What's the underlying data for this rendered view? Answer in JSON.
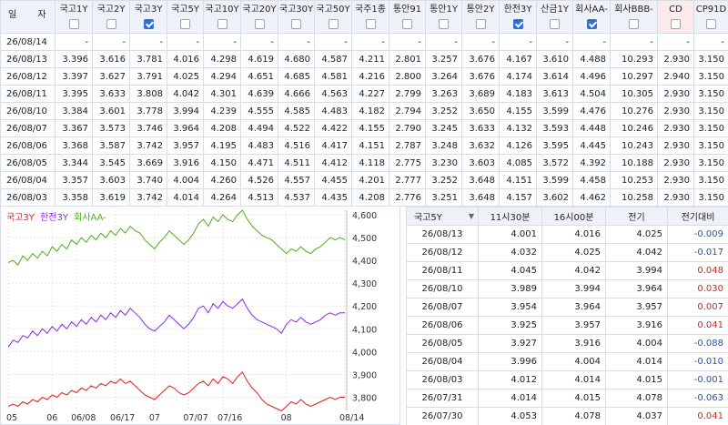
{
  "top": {
    "date_header": "일 자",
    "columns": [
      {
        "label": "국고1Y",
        "checked": false
      },
      {
        "label": "국고2Y",
        "checked": false
      },
      {
        "label": "국고3Y",
        "checked": true
      },
      {
        "label": "국고5Y",
        "checked": false
      },
      {
        "label": "국고10Y",
        "checked": false
      },
      {
        "label": "국고20Y",
        "checked": false
      },
      {
        "label": "국고30Y",
        "checked": false
      },
      {
        "label": "국고50Y",
        "checked": false
      },
      {
        "label": "국주1종",
        "checked": false
      },
      {
        "label": "통안91",
        "checked": false
      },
      {
        "label": "통안1Y",
        "checked": false
      },
      {
        "label": "통안2Y",
        "checked": false
      },
      {
        "label": "한전3Y",
        "checked": true
      },
      {
        "label": "산금1Y",
        "checked": false
      },
      {
        "label": "회사AA-",
        "checked": true
      },
      {
        "label": "회사BBB-",
        "checked": false
      },
      {
        "label": "CD",
        "checked": false
      },
      {
        "label": "CP91D",
        "checked": false
      }
    ],
    "rows": [
      {
        "date": "26/08/14",
        "values": [
          "-",
          "-",
          "-",
          "-",
          "-",
          "-",
          "-",
          "-",
          "-",
          "-",
          "-",
          "-",
          "-",
          "-",
          "-",
          "-",
          "-",
          "-"
        ]
      },
      {
        "date": "26/08/13",
        "values": [
          "3.396",
          "3.616",
          "3.781",
          "4.016",
          "4.298",
          "4.619",
          "4.680",
          "4.587",
          "4.211",
          "2.801",
          "3.257",
          "3.676",
          "4.167",
          "3.610",
          "4.488",
          "10.293",
          "2.930",
          "3.150"
        ]
      },
      {
        "date": "26/08/12",
        "values": [
          "3.397",
          "3.627",
          "3.791",
          "4.025",
          "4.294",
          "4.651",
          "4.685",
          "4.581",
          "4.216",
          "2.800",
          "3.264",
          "3.676",
          "4.174",
          "3.614",
          "4.496",
          "10.297",
          "2.940",
          "3.150"
        ]
      },
      {
        "date": "26/08/11",
        "values": [
          "3.395",
          "3.633",
          "3.808",
          "4.042",
          "4.301",
          "4.639",
          "4.666",
          "4.563",
          "4.227",
          "2.799",
          "3.263",
          "3.689",
          "4.183",
          "3.613",
          "4.504",
          "10.305",
          "2.930",
          "3.150"
        ]
      },
      {
        "date": "26/08/10",
        "values": [
          "3.384",
          "3.601",
          "3.778",
          "3.994",
          "4.239",
          "4.555",
          "4.585",
          "4.483",
          "4.182",
          "2.794",
          "3.252",
          "3.650",
          "4.155",
          "3.599",
          "4.476",
          "10.276",
          "2.930",
          "3.150"
        ]
      },
      {
        "date": "26/08/07",
        "values": [
          "3.367",
          "3.573",
          "3.746",
          "3.964",
          "4.208",
          "4.494",
          "4.522",
          "4.422",
          "4.155",
          "2.790",
          "3.245",
          "3.633",
          "4.132",
          "3.593",
          "4.448",
          "10.246",
          "2.930",
          "3.150"
        ]
      },
      {
        "date": "26/08/06",
        "values": [
          "3.368",
          "3.587",
          "3.742",
          "3.957",
          "4.195",
          "4.483",
          "4.516",
          "4.417",
          "4.151",
          "2.787",
          "3.248",
          "3.632",
          "4.126",
          "3.595",
          "4.445",
          "10.243",
          "2.930",
          "3.150"
        ]
      },
      {
        "date": "26/08/05",
        "values": [
          "3.344",
          "3.545",
          "3.669",
          "3.916",
          "4.150",
          "4.471",
          "4.511",
          "4.412",
          "4.118",
          "2.775",
          "3.230",
          "3.603",
          "4.085",
          "3.572",
          "4.392",
          "10.188",
          "2.930",
          "3.150"
        ]
      },
      {
        "date": "26/08/04",
        "values": [
          "3.357",
          "3.603",
          "3.740",
          "4.004",
          "4.260",
          "4.526",
          "4.557",
          "4.455",
          "4.201",
          "2.777",
          "3.252",
          "3.648",
          "4.151",
          "3.599",
          "4.458",
          "10.253",
          "2.930",
          "3.150"
        ]
      },
      {
        "date": "26/08/03",
        "values": [
          "3.358",
          "3.619",
          "3.742",
          "4.014",
          "4.264",
          "4.513",
          "4.537",
          "4.435",
          "4.208",
          "2.776",
          "3.251",
          "3.648",
          "4.157",
          "3.602",
          "4.462",
          "10.258",
          "2.930",
          "3.150"
        ]
      }
    ]
  },
  "chart": {
    "legend": [
      {
        "label": "국고3Y",
        "color": "#e02020"
      },
      {
        "label": "한전3Y",
        "color": "#8a2be2"
      },
      {
        "label": "회사AA-",
        "color": "#4caf1a"
      }
    ],
    "x_ticks": [
      "05",
      "06",
      "06/08",
      "06/17",
      "07",
      "07/07",
      "07/16",
      "08",
      "08/14"
    ],
    "y_ticks": [
      "4,600",
      "4,500",
      "4,400",
      "4,300",
      "4,200",
      "4,100",
      "4,000",
      "3,900",
      "3,800"
    ]
  },
  "chart_data": {
    "type": "line",
    "ylim": [
      3.75,
      4.62
    ],
    "x_count": 70,
    "series": [
      {
        "name": "회사AA-",
        "color": "#4caf1a",
        "values": [
          4.39,
          4.4,
          4.38,
          4.42,
          4.4,
          4.43,
          4.41,
          4.44,
          4.42,
          4.46,
          4.44,
          4.47,
          4.45,
          4.49,
          4.47,
          4.5,
          4.48,
          4.51,
          4.49,
          4.52,
          4.5,
          4.53,
          4.51,
          4.54,
          4.52,
          4.55,
          4.53,
          4.52,
          4.49,
          4.47,
          4.45,
          4.48,
          4.5,
          4.53,
          4.51,
          4.49,
          4.47,
          4.49,
          4.52,
          4.56,
          4.58,
          4.55,
          4.59,
          4.57,
          4.6,
          4.58,
          4.57,
          4.6,
          4.62,
          4.58,
          4.55,
          4.53,
          4.51,
          4.5,
          4.49,
          4.47,
          4.45,
          4.43,
          4.45,
          4.44,
          4.46,
          4.44,
          4.43,
          4.45,
          4.46,
          4.48,
          4.5,
          4.49,
          4.5,
          4.49
        ]
      },
      {
        "name": "한전3Y",
        "color": "#8a2be2",
        "values": [
          4.02,
          4.05,
          4.04,
          4.07,
          4.06,
          4.09,
          4.07,
          4.1,
          4.08,
          4.11,
          4.09,
          4.12,
          4.1,
          4.13,
          4.11,
          4.14,
          4.12,
          4.15,
          4.13,
          4.16,
          4.14,
          4.17,
          4.15,
          4.18,
          4.16,
          4.19,
          4.17,
          4.15,
          4.12,
          4.1,
          4.09,
          4.11,
          4.13,
          4.16,
          4.14,
          4.12,
          4.1,
          4.12,
          4.15,
          4.19,
          4.2,
          4.17,
          4.21,
          4.19,
          4.22,
          4.2,
          4.19,
          4.21,
          4.23,
          4.19,
          4.16,
          4.14,
          4.13,
          4.12,
          4.11,
          4.1,
          4.08,
          4.12,
          4.14,
          4.13,
          4.15,
          4.13,
          4.12,
          4.13,
          4.14,
          4.16,
          4.17,
          4.16,
          4.17,
          4.17
        ]
      },
      {
        "name": "국고3Y",
        "color": "#e02020",
        "values": [
          3.76,
          3.77,
          3.76,
          3.78,
          3.77,
          3.79,
          3.78,
          3.8,
          3.79,
          3.81,
          3.8,
          3.82,
          3.81,
          3.83,
          3.82,
          3.84,
          3.83,
          3.85,
          3.84,
          3.86,
          3.85,
          3.87,
          3.86,
          3.88,
          3.86,
          3.87,
          3.85,
          3.83,
          3.81,
          3.8,
          3.79,
          3.81,
          3.83,
          3.85,
          3.84,
          3.82,
          3.81,
          3.82,
          3.84,
          3.86,
          3.87,
          3.85,
          3.88,
          3.86,
          3.89,
          3.88,
          3.86,
          3.89,
          3.91,
          3.87,
          3.84,
          3.82,
          3.79,
          3.77,
          3.76,
          3.75,
          3.74,
          3.76,
          3.78,
          3.77,
          3.79,
          3.77,
          3.76,
          3.77,
          3.78,
          3.79,
          3.8,
          3.79,
          3.8,
          3.8
        ]
      }
    ]
  },
  "detail": {
    "selector": "국고5Y",
    "headers": [
      "11시30분",
      "16시00분",
      "전기",
      "전기대비"
    ],
    "rows": [
      {
        "date": "26/08/13",
        "a": "4.001",
        "b": "4.016",
        "c": "4.025",
        "d": "-0.009",
        "sign": "neg"
      },
      {
        "date": "26/08/12",
        "a": "4.032",
        "b": "4.025",
        "c": "4.042",
        "d": "-0.017",
        "sign": "neg"
      },
      {
        "date": "26/08/11",
        "a": "4.045",
        "b": "4.042",
        "c": "3.994",
        "d": "0.048",
        "sign": "pos"
      },
      {
        "date": "26/08/10",
        "a": "3.989",
        "b": "3.994",
        "c": "3.964",
        "d": "0.030",
        "sign": "pos"
      },
      {
        "date": "26/08/07",
        "a": "3.954",
        "b": "3.964",
        "c": "3.957",
        "d": "0.007",
        "sign": "pos"
      },
      {
        "date": "26/08/06",
        "a": "3.925",
        "b": "3.957",
        "c": "3.916",
        "d": "0.041",
        "sign": "pos"
      },
      {
        "date": "26/08/05",
        "a": "3.927",
        "b": "3.916",
        "c": "4.004",
        "d": "-0.088",
        "sign": "neg"
      },
      {
        "date": "26/08/04",
        "a": "3.996",
        "b": "4.004",
        "c": "4.014",
        "d": "-0.010",
        "sign": "neg"
      },
      {
        "date": "26/08/03",
        "a": "4.012",
        "b": "4.014",
        "c": "4.015",
        "d": "-0.001",
        "sign": "neg"
      },
      {
        "date": "26/07/31",
        "a": "4.014",
        "b": "4.015",
        "c": "4.078",
        "d": "-0.063",
        "sign": "neg"
      },
      {
        "date": "26/07/30",
        "a": "4.053",
        "b": "4.078",
        "c": "4.037",
        "d": "0.041",
        "sign": "pos"
      }
    ]
  }
}
